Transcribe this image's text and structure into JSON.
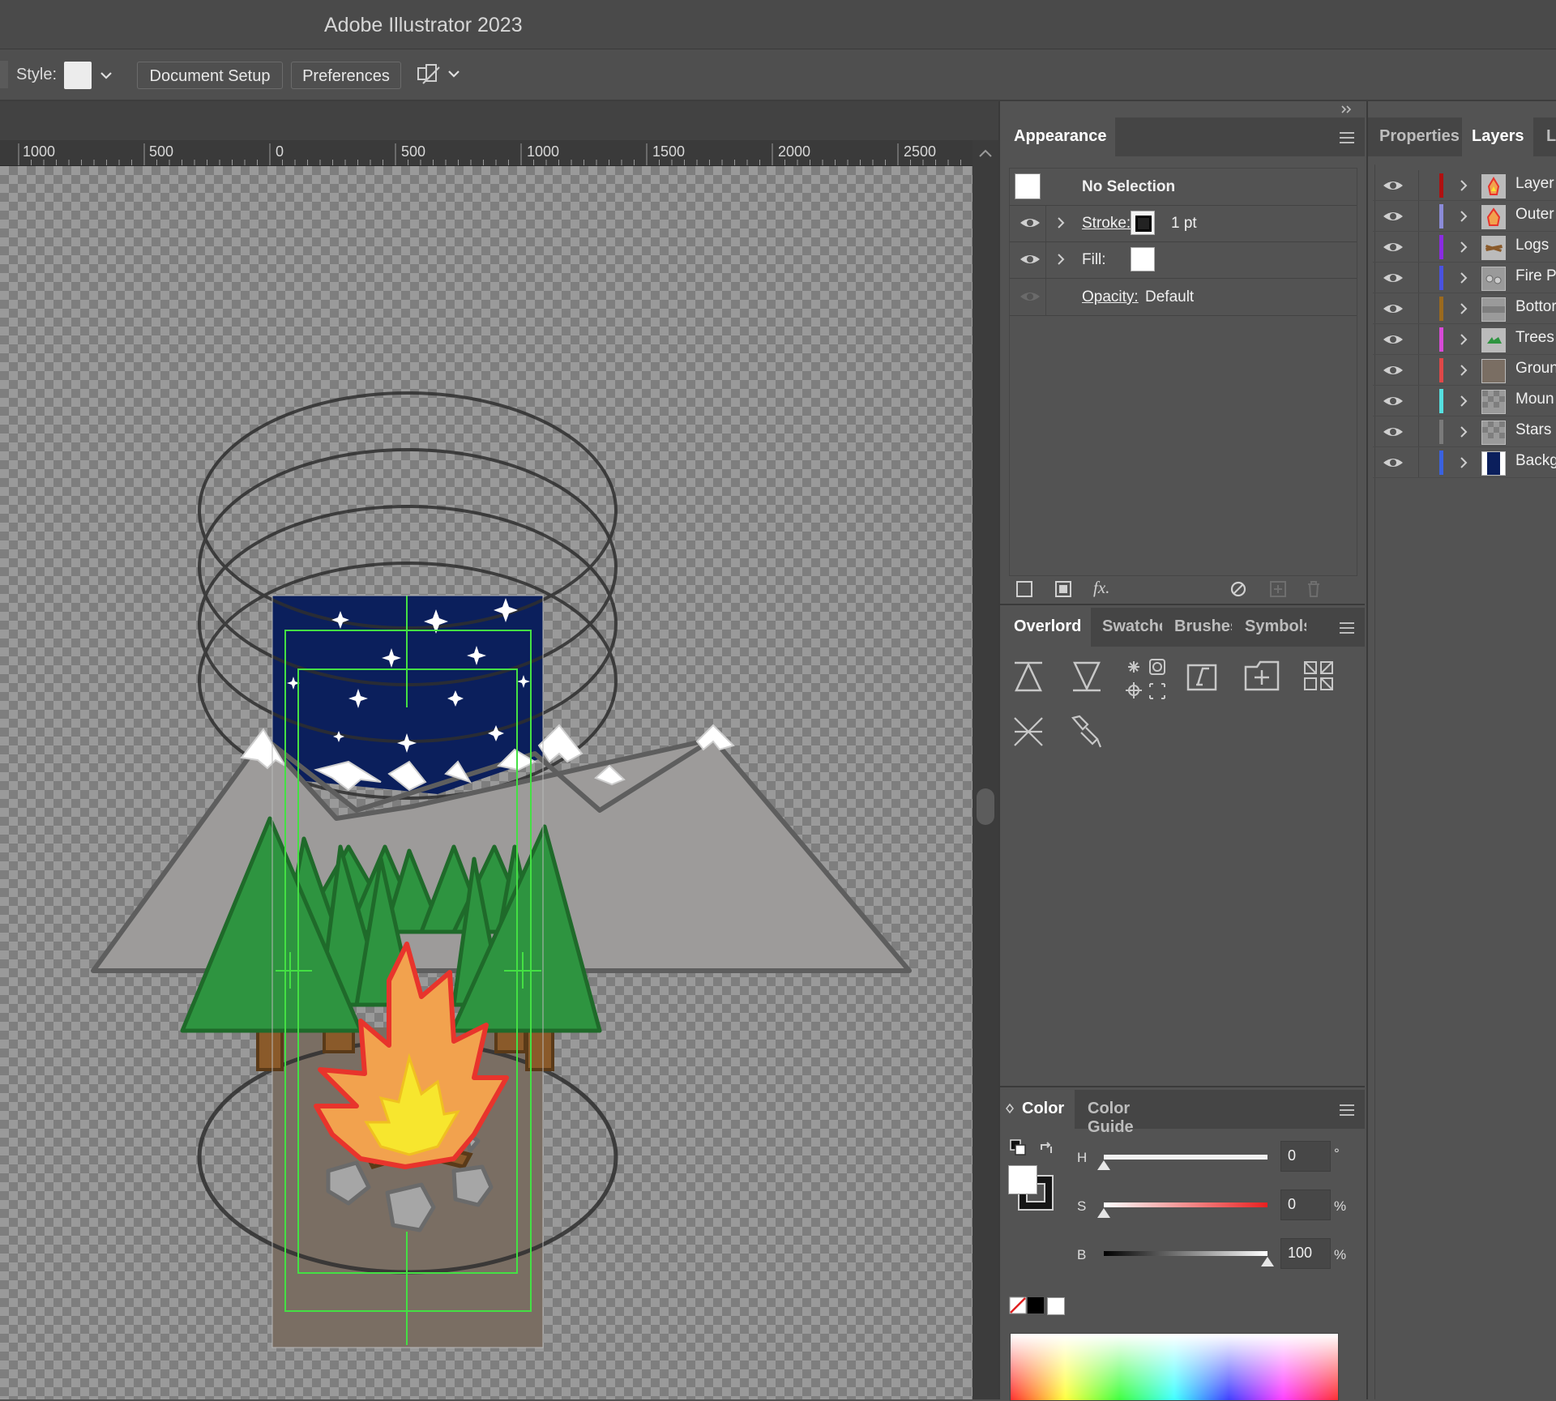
{
  "app": {
    "title": "Adobe Illustrator 2023"
  },
  "control_bar": {
    "style_label": "Style:",
    "document_setup": "Document Setup",
    "preferences": "Preferences"
  },
  "ruler": {
    "ticks": [
      "1000",
      "500",
      "0",
      "500",
      "1000",
      "1500",
      "2000",
      "2500"
    ]
  },
  "appearance": {
    "tab": "Appearance",
    "selection": "No Selection",
    "stroke_label": "Stroke:",
    "stroke_value": "1 pt",
    "fill_label": "Fill:",
    "opacity_label": "Opacity:",
    "opacity_value": "Default",
    "fx_label": "fx."
  },
  "right_tabs": {
    "properties": "Properties",
    "layers": "Layers",
    "libraries": "L"
  },
  "layers": [
    {
      "name": "Layer",
      "color": "#b01010"
    },
    {
      "name": "Outer",
      "color": "#8b8bd8"
    },
    {
      "name": "Logs",
      "color": "#8a2be2"
    },
    {
      "name": "Fire Pi",
      "color": "#4a52e0"
    },
    {
      "name": "Bottor",
      "color": "#9b6a1e"
    },
    {
      "name": "Trees",
      "color": "#d84ad8"
    },
    {
      "name": "Groun",
      "color": "#e04848"
    },
    {
      "name": "Moun",
      "color": "#55e0e0"
    },
    {
      "name": "Stars",
      "color": "#7a7a7a"
    },
    {
      "name": "Backg",
      "color": "#3a62e0"
    }
  ],
  "tools_panel": {
    "tabs": [
      "Overlord",
      "Swatche",
      "Brushes",
      "Symbols"
    ],
    "icons": [
      "push-up-icon",
      "push-down-icon",
      "sparkle-target-icon",
      "text-frame-icon",
      "add-artboard-icon",
      "grid-swatch-icon",
      "cross-lines-icon",
      "pen-path-icon"
    ]
  },
  "color_panel": {
    "tabs": [
      "Color",
      "Color Guide"
    ],
    "h_label": "H",
    "h_value": "0",
    "h_unit": "°",
    "h_fraction": 0.0,
    "s_label": "S",
    "s_value": "0",
    "s_unit": "%",
    "s_fraction": 0.0,
    "b_label": "B",
    "b_value": "100",
    "b_unit": "%",
    "b_fraction": 1.0
  },
  "colors": {
    "sky": "#0b1f5c",
    "mountain": "#9d9b9a",
    "tree": "#2e9440",
    "ground": "#7a6e63",
    "fire_outer": "#f2a24e",
    "fire_inner": "#f7e62e",
    "guide": "#44e044"
  }
}
